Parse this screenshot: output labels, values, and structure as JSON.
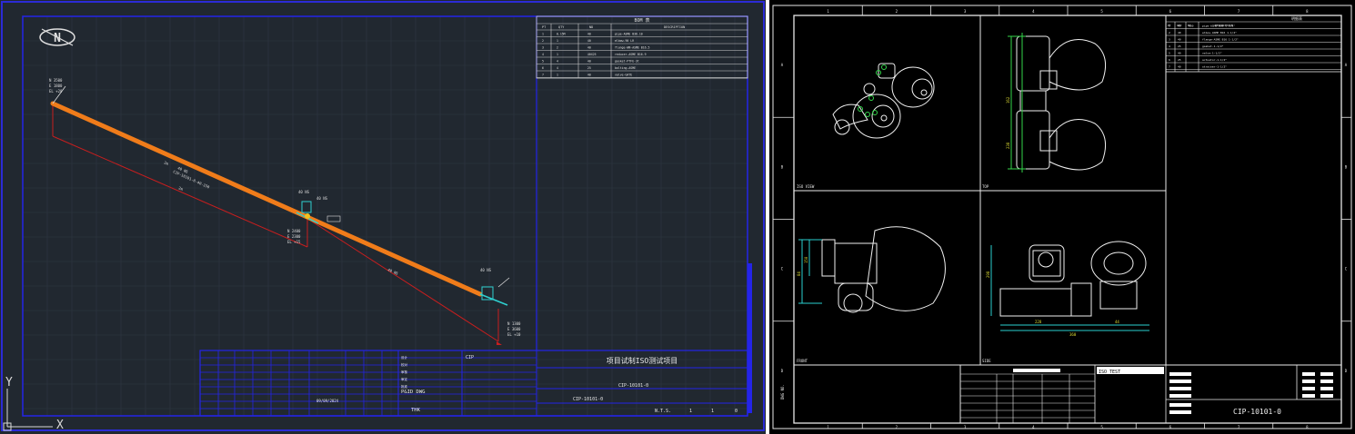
{
  "left": {
    "axis": {
      "y": "Y",
      "x": "X"
    },
    "north_symbol": "N",
    "bom": {
      "title": "BOM 表",
      "headers": [
        "PT",
        "QTY",
        "ND",
        "DESCRIPTION"
      ],
      "rows": [
        [
          "1",
          "0.15M",
          "40",
          "pipe-ASME B36.10"
        ],
        [
          "2",
          "1",
          "40",
          "elbow-90 LR"
        ],
        [
          "3",
          "2",
          "40",
          "flange-WN-ASME B16.5"
        ],
        [
          "4",
          "1",
          "40X25",
          "reducer-ASME B16.9"
        ],
        [
          "5",
          "4",
          "40",
          "gasket-PTFE-3t"
        ],
        [
          "6",
          "4",
          "25",
          "bolting-ASME"
        ],
        [
          "7",
          "1",
          "40",
          "valve-GATE"
        ]
      ]
    },
    "pipe": {
      "line_label": "CIP-10101-0-40-150",
      "length_label_1": "40 NS",
      "length_label_2": "40 NS",
      "dim_1": "2m",
      "dim_2": "2m",
      "start_coords": [
        "N 3500",
        "E 1800",
        "EL +20"
      ],
      "mid_coords": [
        "N 2400",
        "E 2300",
        "EL +15"
      ],
      "end_coords": [
        "N 1300",
        "E 3600",
        "EL +10"
      ],
      "tag_1": "40 NS",
      "tag_2": "40 NS",
      "tag_3": "40 NS"
    },
    "title_block": {
      "project": "项目试制ISO测试项目",
      "drawing_no": "CIP-10101-0",
      "drawing_no_2": "CIP-10101-0",
      "plant": "CIP",
      "pid_label": "P&ID DWG",
      "thk_label": "THK",
      "date": "09/09/2024",
      "scale": "N.T.S.",
      "sheet": "1",
      "of": "1",
      "rev": "0",
      "fields": [
        "设计",
        "校对",
        "审核",
        "审定",
        "批准"
      ]
    }
  },
  "right": {
    "frame": {
      "col_labels": [
        "1",
        "2",
        "3",
        "4",
        "5",
        "6",
        "7",
        "8"
      ],
      "row_labels": [
        "A",
        "B",
        "C",
        "D"
      ]
    },
    "bom": {
      "title": "明细表",
      "headers": [
        "PT",
        "QTY",
        "ND",
        "DESCRIPTION"
      ],
      "rows": [
        [
          "1",
          "40",
          "150",
          "pipe-ASME B36 1-1/2\""
        ],
        [
          "2",
          "40",
          "",
          "elbow-ASME B16 1-1/2\""
        ],
        [
          "3",
          "40",
          "",
          "flange-ASME B16 1-1/2\""
        ],
        [
          "4",
          "25",
          "",
          "gasket-1-1/2\""
        ],
        [
          "5",
          "40",
          "",
          "valve-1-1/2\""
        ],
        [
          "6",
          "25",
          "",
          "actuator-1-1/2\""
        ],
        [
          "7",
          "40",
          "",
          "strainer-1-1/2\""
        ]
      ]
    },
    "views": [
      "ISO VIEW",
      "TOP",
      "FRONT",
      "SIDE"
    ],
    "title_block": {
      "drawing_no": "CIP-10101-0",
      "company": "ISO TEST",
      "side_label": "DWG NO."
    },
    "dims": [
      "162",
      "238",
      "84",
      "150",
      "228",
      "44",
      "360",
      "298"
    ]
  }
}
